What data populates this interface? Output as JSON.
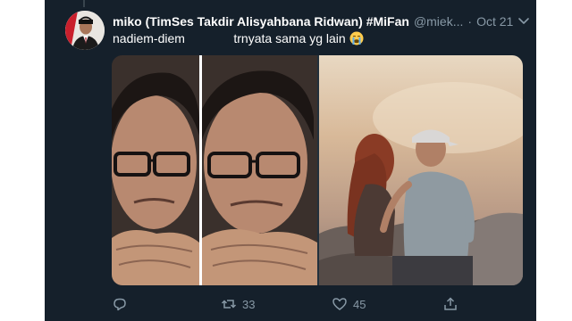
{
  "tweet": {
    "display_name": "miko (TimSes Takdir Alisyahbana Ridwan) #MiFan",
    "handle": "@miek...",
    "separator": "·",
    "date": "Oct 21",
    "text": "nadiem-diem              trnyata sama yg lain",
    "emoji": "crying-face-emoji",
    "avatar": "profile-photo-avatar",
    "media": {
      "left_image": "portrait-collage-glasses-man",
      "right_image": "couple-sitting-on-rock-sunset"
    },
    "actions": {
      "reply_icon": "reply-icon",
      "retweet_icon": "retweet-icon",
      "retweet_count": "33",
      "like_icon": "heart-icon",
      "like_count": "45",
      "share_icon": "share-icon"
    }
  },
  "colors": {
    "background": "#15202b",
    "secondary_text": "#8899a6",
    "primary_text": "#ffffff"
  }
}
